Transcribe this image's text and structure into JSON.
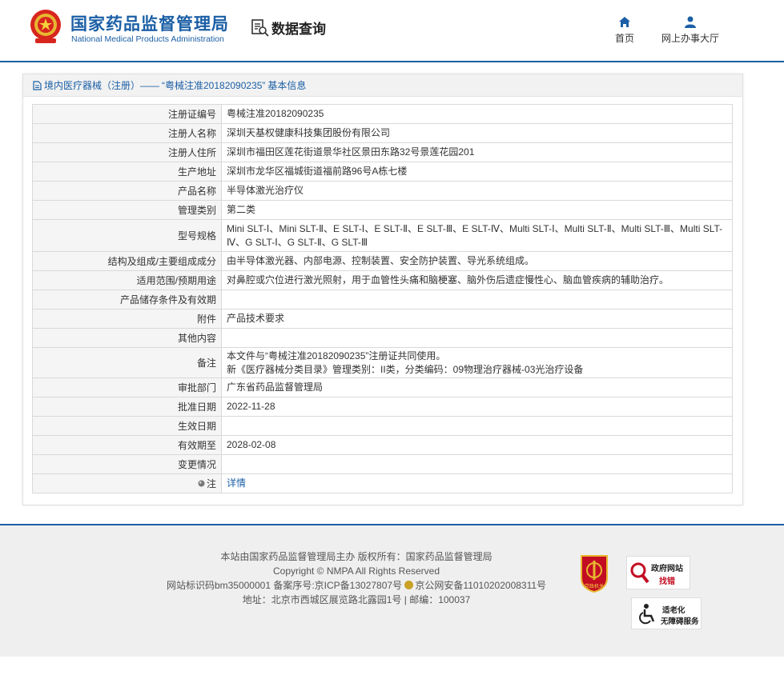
{
  "header": {
    "logo_cn": "国家药品监督管理局",
    "logo_en": "National Medical Products Administration",
    "search_title": "数据查询",
    "nav": [
      {
        "label": "首页",
        "icon": "home-icon"
      },
      {
        "label": "网上办事大厅",
        "icon": "user-icon"
      }
    ]
  },
  "panel": {
    "breadcrumb_prefix": "境内医疗器械（注册）——",
    "breadcrumb_quoted": "“粤械注准20182090235”",
    "breadcrumb_suffix": "基本信息",
    "rows": [
      {
        "key": "注册证编号",
        "value": "粤械注准20182090235"
      },
      {
        "key": "注册人名称",
        "value": "深圳天基权健康科技集团股份有限公司"
      },
      {
        "key": "注册人住所",
        "value": "深圳市福田区莲花街道景华社区景田东路32号景莲花园201"
      },
      {
        "key": "生产地址",
        "value": "深圳市龙华区福城街道福前路96号A栋七楼"
      },
      {
        "key": "产品名称",
        "value": "半导体激光治疗仪"
      },
      {
        "key": "管理类别",
        "value": "第二类"
      },
      {
        "key": "型号规格",
        "value": "Mini SLT-Ⅰ、Mini SLT-Ⅱ、E SLT-Ⅰ、E SLT-Ⅱ、E SLT-Ⅲ、E SLT-Ⅳ、Multi SLT-Ⅰ、Multi SLT-Ⅱ、Multi SLT-Ⅲ、Multi SLT-Ⅳ、G SLT-Ⅰ、G SLT-Ⅱ、G SLT-Ⅲ"
      },
      {
        "key": "结构及组成/主要组成成分",
        "value": "由半导体激光器、内部电源、控制装置、安全防护装置、导光系统组成。"
      },
      {
        "key": "适用范围/预期用途",
        "value": "对鼻腔或穴位进行激光照射，用于血管性头痛和脑梗塞、脑外伤后遗症慢性心、脑血管疾病的辅助治疗。"
      },
      {
        "key": "产品储存条件及有效期",
        "value": ""
      },
      {
        "key": "附件",
        "value": "产品技术要求"
      },
      {
        "key": "其他内容",
        "value": ""
      },
      {
        "key": "备注",
        "value_line1": "本文件与“粤械注准20182090235”注册证共同使用。",
        "value_line2": "新《医疗器械分类目录》管理类别：II类，分类编码：09物理治疗器械-03光治疗设备"
      },
      {
        "key": "审批部门",
        "value": "广东省药品监督管理局"
      },
      {
        "key": "批准日期",
        "value": "2022-11-28"
      },
      {
        "key": "生效日期",
        "value": ""
      },
      {
        "key": "有效期至",
        "value": "2028-02-08"
      },
      {
        "key": "变更情况",
        "value": ""
      },
      {
        "key": "注",
        "value": "详情"
      }
    ]
  },
  "footer": {
    "line1": "本站由国家药品监督管理局主办 版权所有：国家药品监督管理局",
    "line2": "Copyright © NMPA All Rights Reserved",
    "line3_a": "网站标识码bm35000001    备案序号:京ICP备13027807号",
    "line3_b": "京公网安备11010202008311号",
    "line4": "地址：北京市西城区展览路北露园1号 | 邮编：100037",
    "badge_red_label": "党政机关",
    "badge_gov_t1": "政府网站",
    "badge_gov_t2": "找错",
    "badge_acc_t1": "适老化",
    "badge_acc_t2": "无障碍服务"
  },
  "colors": {
    "brand_blue": "#1b5fa5",
    "badge_red": "#c30d23"
  }
}
